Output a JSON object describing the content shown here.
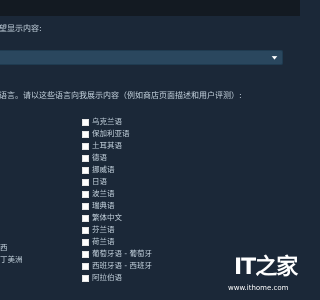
{
  "section_display": {
    "heading": "望显示内容:",
    "select_value": ""
  },
  "section_languages": {
    "heading": "语言。请以这些语言向我展示内容（例如商店页面描述和用户评测）:",
    "languages": [
      {
        "label": "乌克兰语",
        "checked": false
      },
      {
        "label": "保加利亚语",
        "checked": false
      },
      {
        "label": "土耳其语",
        "checked": false
      },
      {
        "label": "德语",
        "checked": false
      },
      {
        "label": "挪威语",
        "checked": false
      },
      {
        "label": "日语",
        "checked": false
      },
      {
        "label": "波兰语",
        "checked": false
      },
      {
        "label": "瑞典语",
        "checked": false
      },
      {
        "label": "繁体中文",
        "checked": false
      },
      {
        "label": "芬兰语",
        "checked": false
      },
      {
        "label": "荷兰语",
        "checked": false
      },
      {
        "label": "葡萄牙语 - 葡萄牙",
        "checked": false
      },
      {
        "label": "西班牙语 - 西班牙",
        "checked": false
      },
      {
        "label": "阿拉伯语",
        "checked": false
      }
    ],
    "left_column": [
      {
        "label": "西"
      },
      {
        "label": "丁美洲"
      }
    ]
  },
  "watermark": {
    "logo_text": "IT之家",
    "url": "www.ithome.com"
  }
}
